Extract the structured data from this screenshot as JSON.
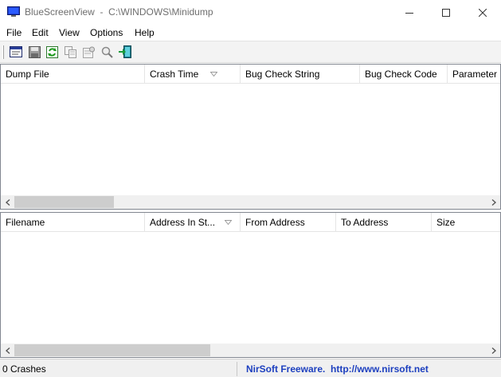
{
  "window": {
    "title": "BlueScreenView  -  C:\\WINDOWS\\Minidump",
    "app_icon": "bluescreenview-app-icon",
    "controls": [
      "minimize-icon",
      "maximize-icon",
      "close-icon"
    ]
  },
  "menu": {
    "items": [
      "File",
      "Edit",
      "View",
      "Options",
      "Help"
    ]
  },
  "toolbar": {
    "buttons": [
      {
        "icon": "html-report-icon"
      },
      {
        "icon": "save-icon"
      },
      {
        "icon": "refresh-icon"
      },
      {
        "icon": "copy-icon"
      },
      {
        "icon": "properties-icon"
      },
      {
        "icon": "find-icon"
      },
      {
        "icon": "exit-icon"
      }
    ]
  },
  "top_table": {
    "columns": [
      "Dump File",
      "Crash Time",
      "Bug Check String",
      "Bug Check Code",
      "Parameter"
    ],
    "sorted_column": "Crash Time",
    "rows": []
  },
  "bottom_table": {
    "columns": [
      "Filename",
      "Address In St...",
      "From Address",
      "To Address",
      "Size"
    ],
    "sorted_column": "Address In St...",
    "rows": []
  },
  "status": {
    "count": "0 Crashes",
    "credit": "NirSoft Freeware.  http://www.nirsoft.net"
  },
  "colors": {
    "credit_text": "#1c3fbf",
    "scroll_thumb": "#cdcdcd",
    "toolbar_bg": "#f3f3f3"
  }
}
